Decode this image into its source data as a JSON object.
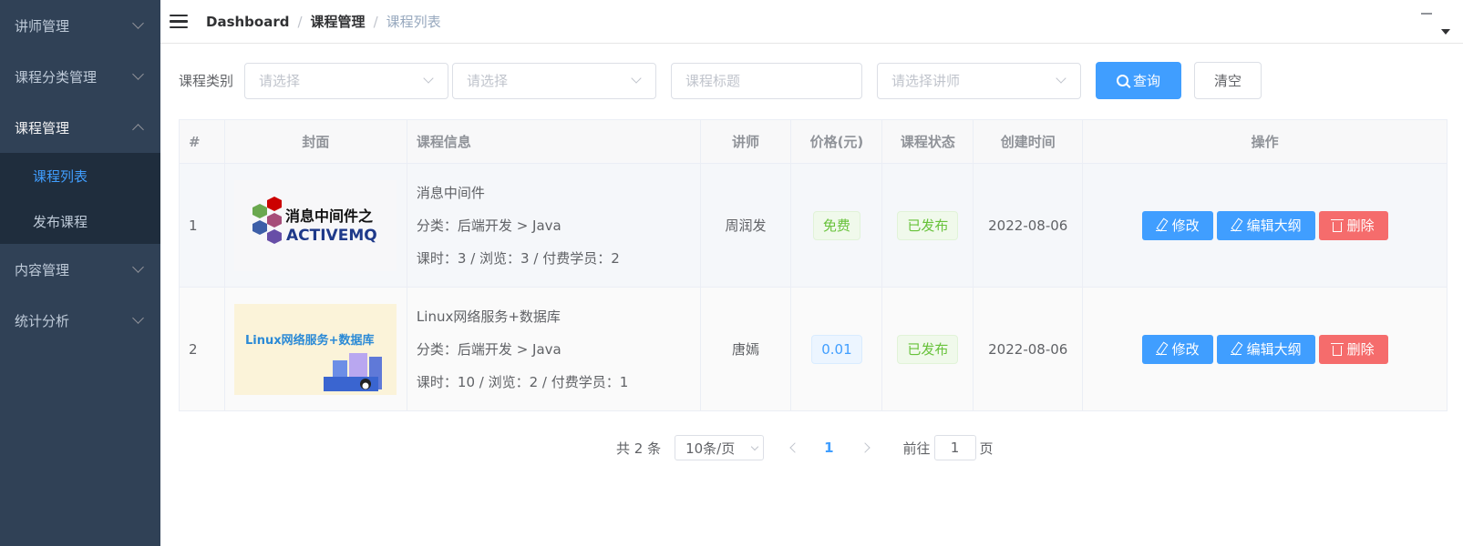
{
  "sidebar": {
    "items": [
      {
        "label": "讲师管理"
      },
      {
        "label": "课程分类管理"
      },
      {
        "label": "课程管理",
        "sub": [
          {
            "label": "课程列表"
          },
          {
            "label": "发布课程"
          }
        ]
      },
      {
        "label": "内容管理"
      },
      {
        "label": "统计分析"
      }
    ]
  },
  "breadcrumb": [
    "Dashboard",
    "课程管理",
    "课程列表"
  ],
  "breadcrumb_sep": "/",
  "filter": {
    "label": "课程类别",
    "select1_placeholder": "请选择",
    "select2_placeholder": "请选择",
    "title_placeholder": "课程标题",
    "teacher_placeholder": "请选择讲师",
    "query_label": "查询",
    "clear_label": "清空"
  },
  "table": {
    "headers": [
      "#",
      "封面",
      "课程信息",
      "讲师",
      "价格(元)",
      "课程状态",
      "创建时间",
      "操作"
    ],
    "rows": [
      {
        "index": "1",
        "cover_text_1": "消息中间件之",
        "cover_text_2": "ACTIVEMQ",
        "title": "消息中间件",
        "category": "分类：后端开发 > Java",
        "stats": "课时：3 / 浏览：3 / 付费学员：2",
        "teacher": "周润发",
        "price": "免费",
        "status": "已发布",
        "created": "2022-08-06"
      },
      {
        "index": "2",
        "cover_text_1": "Linux网络服务+数据库",
        "title": "Linux网络服务+数据库",
        "category": "分类：后端开发 > Java",
        "stats": "课时：10 / 浏览：2 / 付费学员：1",
        "teacher": "唐嫣",
        "price": "0.01",
        "status": "已发布",
        "created": "2022-08-06"
      }
    ],
    "actions": {
      "edit": "修改",
      "outline": "编辑大纲",
      "delete": "删除"
    }
  },
  "pagination": {
    "total": "共 2 条",
    "page_size": "10条/页",
    "current": "1",
    "goto_prefix": "前往",
    "goto_value": "1",
    "goto_suffix": "页"
  },
  "colors": {
    "sidebar_bg": "#304156",
    "primary": "#409eff",
    "danger": "#f56c6c",
    "success": "#67c23a"
  }
}
